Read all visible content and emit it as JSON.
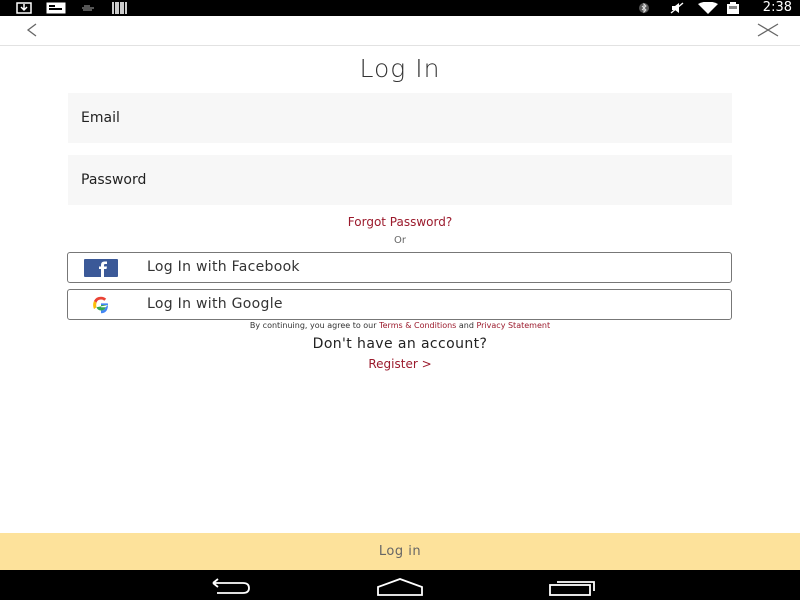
{
  "status_bar": {
    "time": "2:38",
    "left_icons": [
      "download-icon",
      "message-icon",
      "signal-dots-icon",
      "barcode-icon"
    ],
    "right_icons": [
      "bluetooth-icon",
      "mute-icon",
      "wifi-icon",
      "battery-icon"
    ]
  },
  "top_bar": {
    "back_icon": "chevron-left-icon",
    "close_icon": "close-icon"
  },
  "title": "Log In",
  "form": {
    "email_placeholder": "Email",
    "password_placeholder": "Password",
    "forgot_password": "Forgot Password?",
    "or_label": "Or"
  },
  "social": {
    "facebook_label": "Log In with Facebook",
    "google_label": "Log In with Google"
  },
  "legal": {
    "prefix": "By continuing, you agree to our ",
    "terms": "Terms & Conditions",
    "and": " and ",
    "privacy": "Privacy Statement"
  },
  "register": {
    "question": "Don't have an account?",
    "link": "Register >"
  },
  "login_button": "Log in",
  "colors": {
    "accent": "#9b1a2c",
    "login_bar": "#fde29b",
    "field_bg": "#f7f7f7",
    "facebook": "#3b5998"
  }
}
